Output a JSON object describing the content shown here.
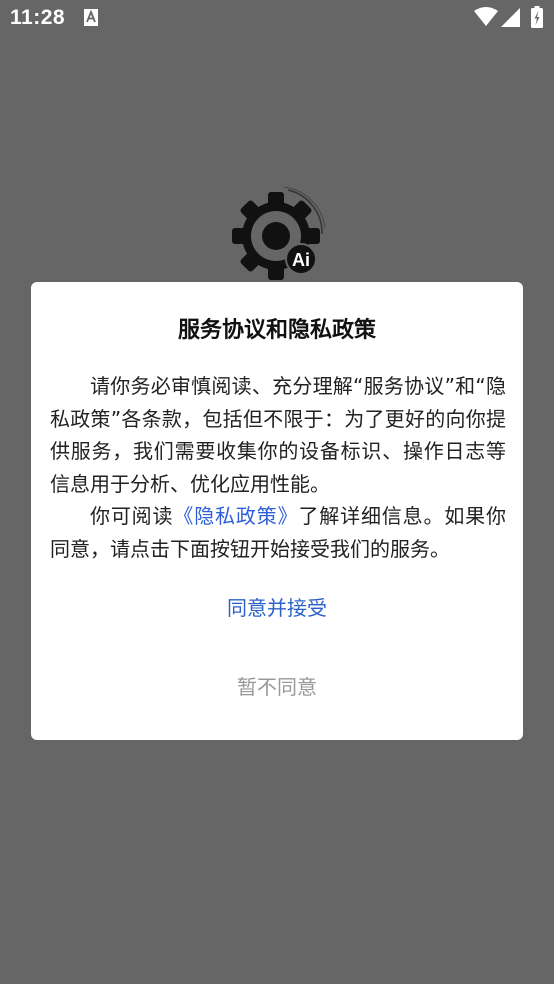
{
  "status_bar": {
    "time": "11:28",
    "icons": [
      "a-notification-icon",
      "wifi-icon",
      "signal-icon",
      "battery-icon"
    ]
  },
  "app": {
    "logo_icon": "gear-ai-icon",
    "logo_badge": "Ai"
  },
  "dialog": {
    "title": "服务协议和隐私政策",
    "paragraph1": "请你务必审慎阅读、充分理解“服务协议”和“隐私政策”各条款，包括但不限于：为了更好的向你提供服务，我们需要收集你的设备标识、操作日志等信息用于分析、优化应用性能。",
    "paragraph2_before": "你可阅读",
    "policy_link": "《隐私政策》",
    "paragraph2_after": "了解详细信息。如果你同意，请点击下面按钮开始接受我们的服务。",
    "agree_label": "同意并接受",
    "disagree_label": "暂不同意"
  },
  "colors": {
    "overlay": "#666666",
    "dialog_bg": "#ffffff",
    "link": "#2f5fd8",
    "primary_button": "#2a62c9",
    "secondary_button": "#999999"
  }
}
